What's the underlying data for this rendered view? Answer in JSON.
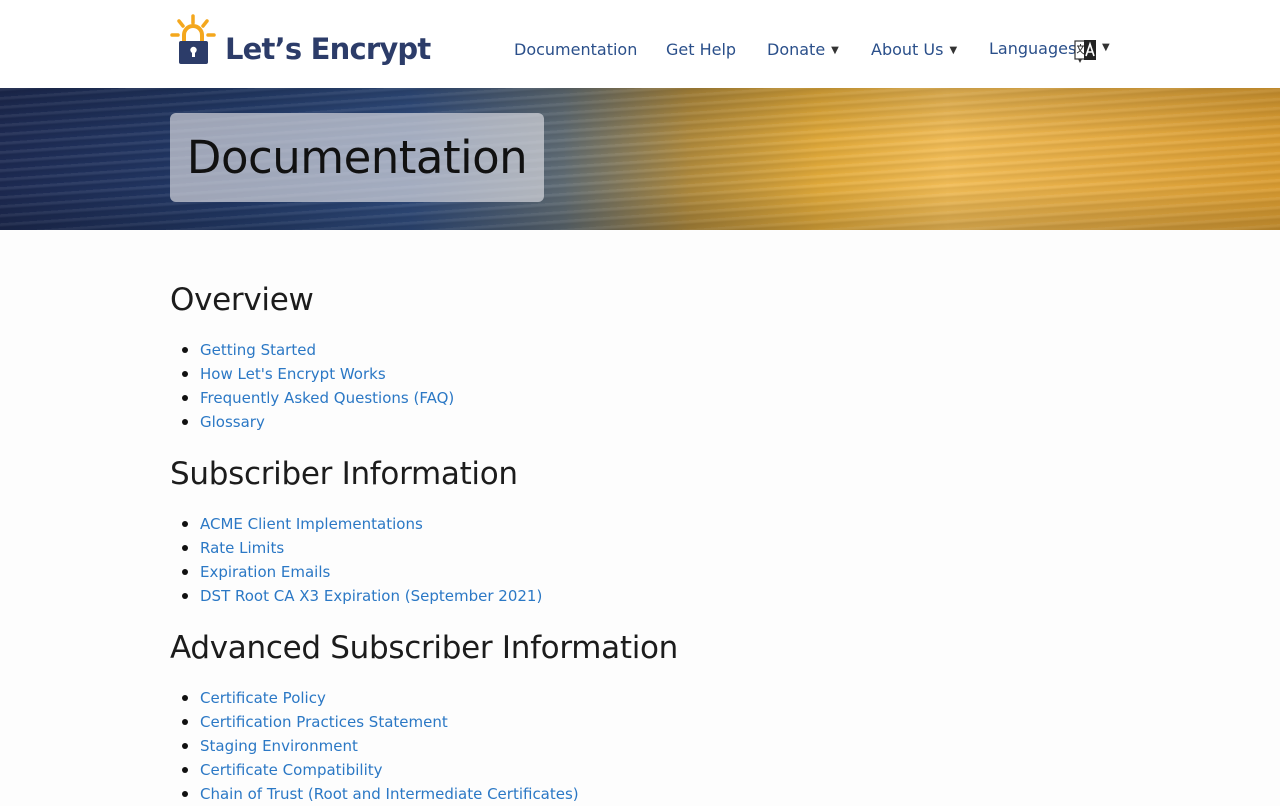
{
  "brand": {
    "name": "Let’s Encrypt"
  },
  "nav": {
    "items": [
      {
        "label": "Documentation"
      },
      {
        "label": "Get Help"
      },
      {
        "label": "Donate",
        "caret": "▼"
      },
      {
        "label": "About Us",
        "caret": "▼"
      },
      {
        "label": "Languages",
        "caret": "▼",
        "icon": "translate-icon"
      }
    ]
  },
  "hero": {
    "title": "Documentation"
  },
  "sections": [
    {
      "heading": "Overview",
      "links": [
        "Getting Started",
        "How Let's Encrypt Works",
        "Frequently Asked Questions (FAQ)",
        "Glossary"
      ]
    },
    {
      "heading": "Subscriber Information",
      "links": [
        "ACME Client Implementations",
        "Rate Limits",
        "Expiration Emails",
        "DST Root CA X3 Expiration (September 2021)"
      ]
    },
    {
      "heading": "Advanced Subscriber Information",
      "links": [
        "Certificate Policy",
        "Certification Practices Statement",
        "Staging Environment",
        "Certificate Compatibility",
        "Chain of Trust (Root and Intermediate Certificates)"
      ]
    }
  ],
  "colors": {
    "brand_navy": "#2c3c69",
    "brand_orange": "#f4a71d",
    "nav_link": "#2a4f8a",
    "content_link": "#2b78c5"
  }
}
